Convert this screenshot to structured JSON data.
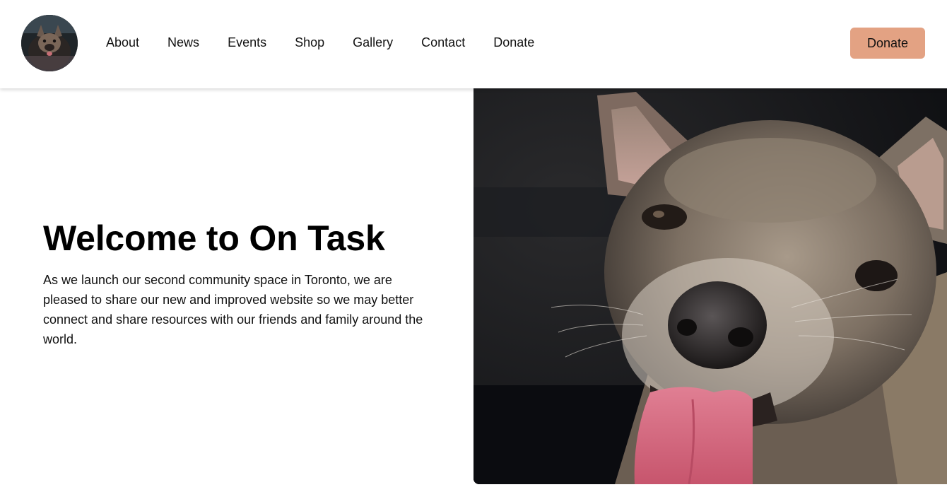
{
  "header": {
    "logo_alt": "On Task logo",
    "nav": [
      {
        "label": "About"
      },
      {
        "label": "News"
      },
      {
        "label": "Events"
      },
      {
        "label": "Shop"
      },
      {
        "label": "Gallery"
      },
      {
        "label": "Contact"
      },
      {
        "label": "Donate"
      }
    ],
    "donate_button": "Donate"
  },
  "hero": {
    "title": "Welcome to On Task",
    "body": "As we launch our second community space in Toronto, we are pleased to share our new and improved website so we may better connect and share resources with our friends and family around the world.",
    "image_subject": "chihuahua-photo"
  },
  "colors": {
    "accent": "#e3a283",
    "text": "#111111",
    "background": "#ffffff"
  }
}
